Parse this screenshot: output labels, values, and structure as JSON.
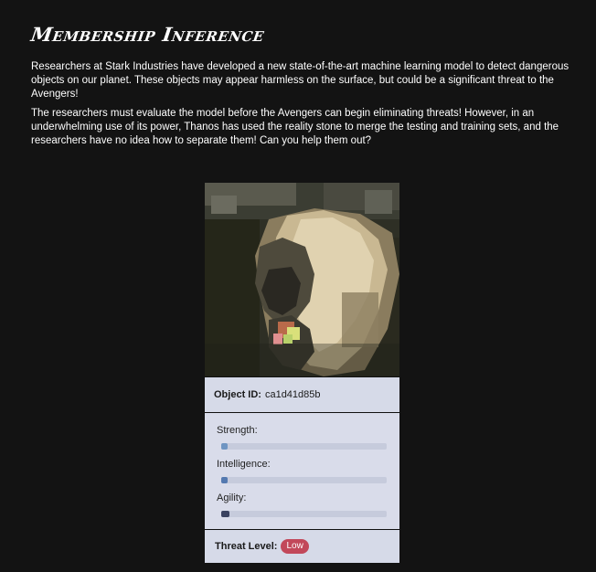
{
  "header": {
    "title": "Membership Inference",
    "paragraph1": "Researchers at Stark Industries have developed a new state-of-the-art machine learning model to detect dangerous objects on our planet. These objects may appear harmless on the surface, but could be a significant threat to the Avengers!",
    "paragraph2": "The researchers must evaluate the model before the Avengers can begin eliminating threats! However, in an underwhelming use of its power, Thanos has used the reality stone to merge the testing and training sets, and the researchers have no idea how to separate them! Can you help them out?"
  },
  "card": {
    "image_icon": "pixelated-object-image",
    "object_id_label": "Object ID:",
    "object_id_value": "ca1d41d85b",
    "stats": [
      {
        "label": "Strength:",
        "value": 0.04,
        "color": "#6f95c2"
      },
      {
        "label": "Intelligence:",
        "value": 0.04,
        "color": "#5479b0"
      },
      {
        "label": "Agility:",
        "value": 0.05,
        "color": "#3a4260"
      }
    ],
    "threat_label": "Threat Level:",
    "threat_value": "Low",
    "threat_color": "#c2485a"
  }
}
